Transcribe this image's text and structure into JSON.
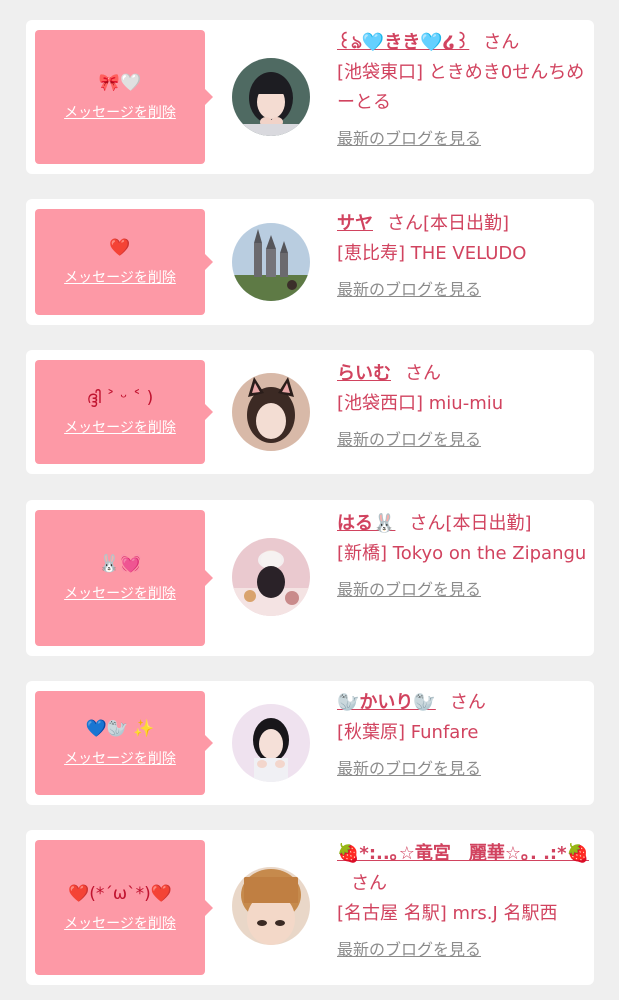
{
  "delete_label": "メッセージを削除",
  "san_label": "さん",
  "blog_label": "最新のブログを見る",
  "accent_color": "#fd99a6",
  "name_color": "#d1435f",
  "cards": [
    {
      "message": "🎀🤍",
      "name": "꒰ঌ🩵きき🩵໒꒱",
      "status": "",
      "shop": "[池袋東口] ときめき0せんちめーとる",
      "avatar": "girl-dark-hair-icon"
    },
    {
      "message": "❤️",
      "name": "サヤ",
      "status": "[本日出勤]",
      "shop": "[恵比寿] THE VELUDO",
      "avatar": "castle-photo-icon"
    },
    {
      "message": "ദ്ദി ˃ ᵕ ˂ )",
      "name": "らいむ",
      "status": "",
      "shop": "[池袋西口] miu-miu",
      "avatar": "cat-ears-girl-icon"
    },
    {
      "message": "🐰💓",
      "name": "はる🐰",
      "status": "[本日出勤]",
      "shop": "[新橋] Tokyo on the Zipangu",
      "avatar": "cafe-photo-icon"
    },
    {
      "message": "💙🦭 ✨",
      "name": "🦭かいり🦭",
      "status": "",
      "shop": "[秋葉原] Funfare",
      "avatar": "idol-girl-icon"
    },
    {
      "message": "❤️(*´ω`*)❤️",
      "name": "🍓*:..｡☆竜宮　麗華☆｡. .:*🍓",
      "status": "",
      "shop": "[名古屋 名駅] mrs.J 名駅西",
      "avatar": "blonde-girl-icon"
    }
  ]
}
